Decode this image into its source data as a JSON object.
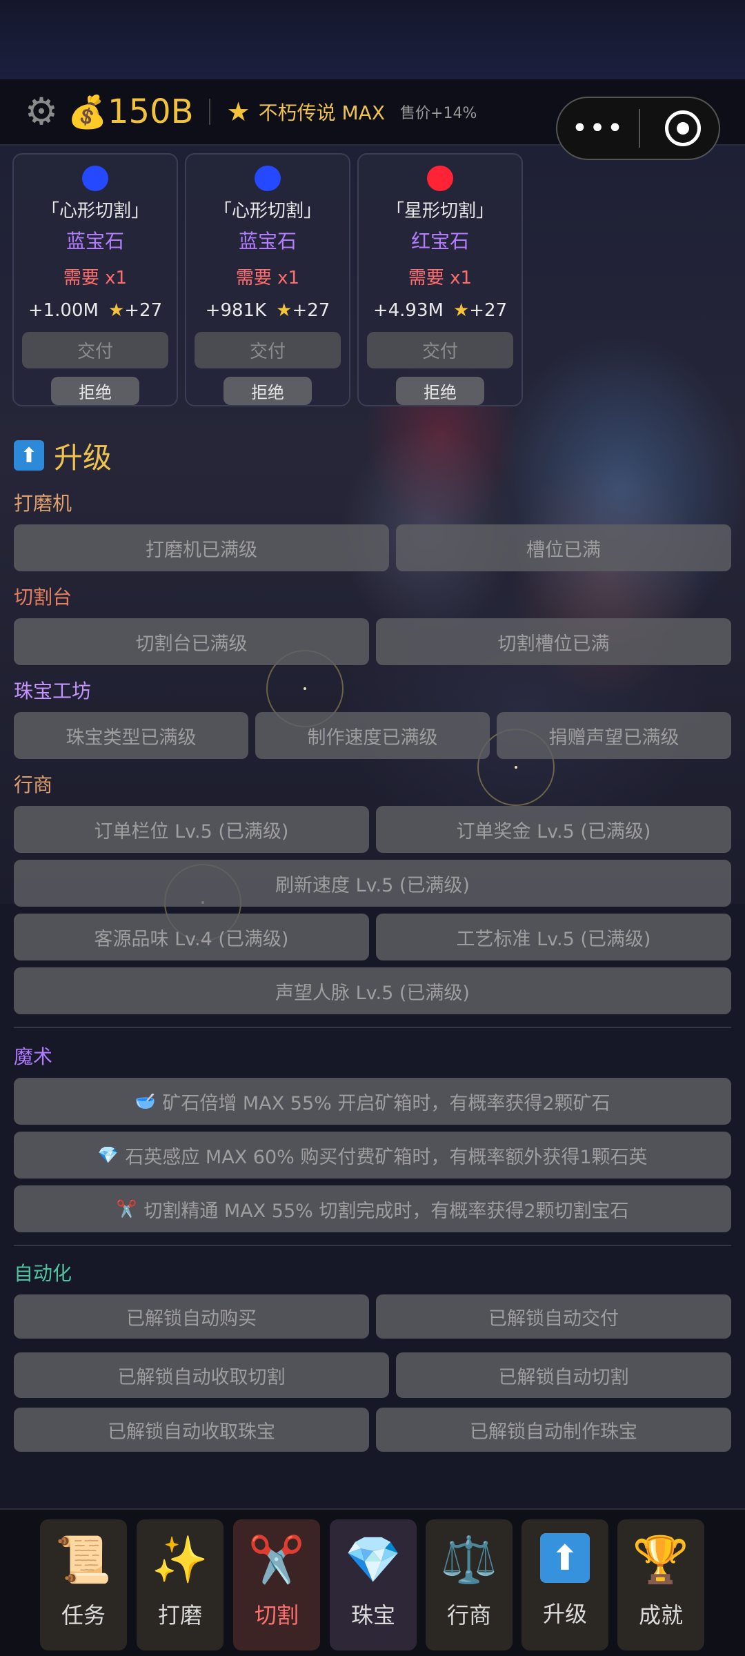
{
  "topbar": {
    "money": "150B",
    "rank": "不朽传说 MAX",
    "sale_bonus": "售价+14%",
    "capsule_dots": "•••"
  },
  "orders": [
    {
      "name": "「心形切割」",
      "gem_type": "蓝宝石",
      "need": "需要 x1",
      "reward_money": "+1.00M",
      "reward_star": "+27",
      "deliver": "交付",
      "reject": "拒绝",
      "gem_color": "#2449ff"
    },
    {
      "name": "「心形切割」",
      "gem_type": "蓝宝石",
      "need": "需要 x1",
      "reward_money": "+981K",
      "reward_star": "+27",
      "deliver": "交付",
      "reject": "拒绝",
      "gem_color": "#2449ff"
    },
    {
      "name": "「星形切割」",
      "gem_type": "红宝石",
      "need": "需要 x1",
      "reward_money": "+4.93M",
      "reward_star": "+27",
      "deliver": "交付",
      "reject": "拒绝",
      "gem_color": "#ff2435"
    }
  ],
  "upgrade": {
    "title": "升级",
    "grinder": {
      "label": "打磨机",
      "buttons": [
        "打磨机已满级",
        "槽位已满"
      ],
      "color": "#e0a070"
    },
    "cutting": {
      "label": "切割台",
      "buttons": [
        "切割台已满级",
        "切割槽位已满"
      ],
      "color": "#e88060"
    },
    "workshop": {
      "label": "珠宝工坊",
      "buttons": [
        "珠宝类型已满级",
        "制作速度已满级",
        "捐赠声望已满级"
      ],
      "color": "#c592ff"
    },
    "merchant": {
      "label": "行商",
      "color": "#e0a070",
      "buttons": [
        "订单栏位 Lv.5 (已满级)",
        "订单奖金 Lv.5 (已满级)",
        "刷新速度 Lv.5 (已满级)",
        "客源品味 Lv.4 (已满级)",
        "工艺标准 Lv.5 (已满级)",
        "声望人脉 Lv.5 (已满级)"
      ]
    }
  },
  "magic": {
    "label": "魔术",
    "color": "#b07cff",
    "items": [
      {
        "icon": "🥣",
        "text": "矿石倍增 MAX 55% 开启矿箱时，有概率获得2颗矿石"
      },
      {
        "icon": "💎",
        "text": "石英感应 MAX 60% 购买付费矿箱时，有概率额外获得1颗石英"
      },
      {
        "icon": "✂️",
        "text": "切割精通 MAX 55% 切割完成时，有概率获得2颗切割宝石"
      }
    ]
  },
  "automation": {
    "label": "自动化",
    "color": "#4fc4a0",
    "buttons": [
      "已解锁自动购买",
      "已解锁自动交付",
      "已解锁自动收取切割",
      "已解锁自动切割",
      "已解锁自动收取珠宝",
      "已解锁自动制作珠宝"
    ]
  },
  "nav": [
    {
      "label": "任务",
      "icon": "📜"
    },
    {
      "label": "打磨",
      "icon": "✨"
    },
    {
      "label": "切割",
      "icon": "✂️"
    },
    {
      "label": "珠宝",
      "icon": "💎"
    },
    {
      "label": "行商",
      "icon": "⚖️"
    },
    {
      "label": "升级",
      "icon": "⬆"
    },
    {
      "label": "成就",
      "icon": "🏆"
    }
  ]
}
